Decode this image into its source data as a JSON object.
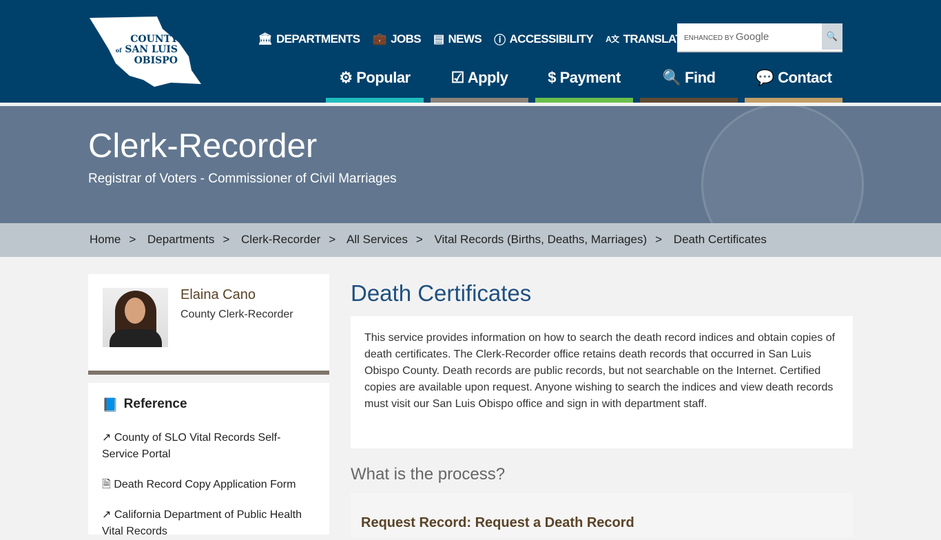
{
  "header": {
    "logo": {
      "line1": "COUNTY",
      "of": "of",
      "line2": "SAN LUIS",
      "line3": "OBISPO"
    },
    "utility_links": [
      {
        "label": "DEPARTMENTS",
        "icon": "building-icon"
      },
      {
        "label": "JOBS",
        "icon": "briefcase-icon"
      },
      {
        "label": "NEWS",
        "icon": "newspaper-icon"
      },
      {
        "label": "ACCESSIBILITY",
        "icon": "accessibility-icon"
      },
      {
        "label": "TRANSLATE",
        "icon": "translate-icon"
      }
    ],
    "search": {
      "placeholder_prefix": "ENHANCED BY",
      "placeholder_brand": "Google",
      "icon": "search-icon"
    },
    "main_nav": [
      {
        "label": "Popular",
        "icon": "gear-icon",
        "color": "#1fbcbc"
      },
      {
        "label": "Apply",
        "icon": "checkbox-icon",
        "color": "#8c8279"
      },
      {
        "label": "Payment",
        "icon": "dollar-icon",
        "color": "#6abf4b"
      },
      {
        "label": "Find",
        "icon": "search-icon",
        "color": "#5f4a32"
      },
      {
        "label": "Contact",
        "icon": "chat-icon",
        "color": "#c29e66"
      }
    ]
  },
  "banner": {
    "title": "Clerk-Recorder",
    "subtitle": "Registrar of Voters - Commissioner of Civil Marriages"
  },
  "breadcrumb": [
    "Home",
    "Departments",
    "Clerk-Recorder",
    "All Services",
    "Vital Records (Births, Deaths, Marriages)",
    "Death Certificates"
  ],
  "sidebar": {
    "person": {
      "name": "Elaina Cano",
      "title": "County Clerk-Recorder"
    },
    "reference": {
      "heading": "Reference",
      "links": [
        {
          "label": "County of SLO Vital Records Self-Service Portal",
          "icon": "external-link-icon"
        },
        {
          "label": "Death Record Copy Application Form",
          "icon": "document-icon"
        },
        {
          "label": "California Department of Public Health Vital Records",
          "icon": "external-link-icon"
        }
      ]
    }
  },
  "main": {
    "title": "Death Certificates",
    "description": "This service provides information on how to search the death record indices and obtain copies of death certificates. The Clerk-Recorder office retains death records that occurred in San Luis Obispo County. Death records are public records, but not searchable on the Internet. Certified copies are available upon request. Anyone wishing to search the indices and view death records must visit our San Luis Obispo office and sign in with department staff.",
    "process_heading": "What is the process?",
    "step_title": "Request Record: Request a Death Record"
  }
}
